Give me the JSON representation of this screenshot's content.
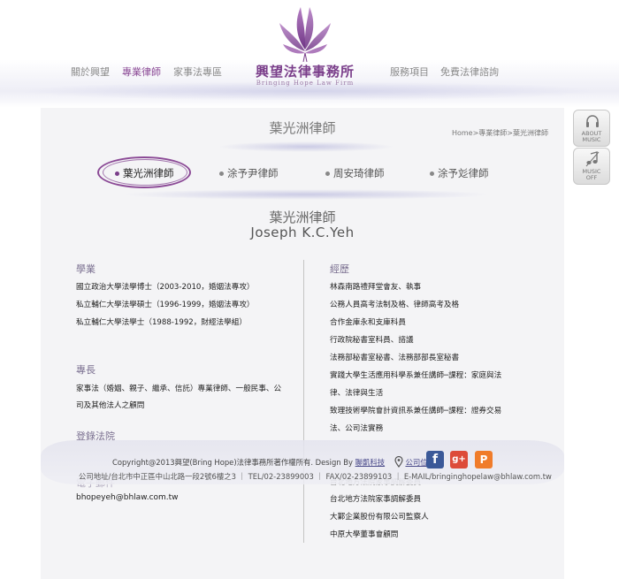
{
  "header": {
    "nav": [
      {
        "label": "關於興望",
        "active": false
      },
      {
        "label": "專業律師",
        "active": true
      },
      {
        "label": "家事法專區",
        "active": false
      },
      {
        "label": "服務項目",
        "active": false
      },
      {
        "label": "免費法律諮詢",
        "active": false
      }
    ],
    "logo": {
      "name": "興望法律事務所",
      "sub": "Bringing Hope Law Firm"
    }
  },
  "music": {
    "on": {
      "line1": "ABOUT",
      "line2": "MUSIC"
    },
    "off": {
      "line1": "MUSIC",
      "line2": "OFF"
    }
  },
  "page": {
    "title": "葉光洲律師",
    "breadcrumb": [
      "Home",
      ">",
      "專業律師",
      ">",
      "葉光洲律師"
    ]
  },
  "lawyers": [
    {
      "name": "葉光洲律師",
      "active": true
    },
    {
      "name": "涂予尹律師",
      "active": false
    },
    {
      "name": "周安琦律師",
      "active": false
    },
    {
      "name": "涂予彣律師",
      "active": false
    }
  ],
  "profile": {
    "name_cn": "葉光洲律師",
    "name_en": "Joseph K.C.Yeh",
    "education": {
      "title": "學業",
      "items": [
        "國立政治大學法學博士（2003-2010，婚姻法專攻）",
        "私立輔仁大學法學碩士（1996-1999，婚姻法專攻）",
        "私立輔仁大學法學士（1988-1992，財經法學組）"
      ]
    },
    "specialty": {
      "title": "專長",
      "lines": [
        "家事法（婚姻、親子、繼承、信託）專業律師、一般民事、公",
        "司及其他法人之顧問"
      ]
    },
    "bar": {
      "title": "登錄法院"
    },
    "contact": {
      "title": "電子郵件",
      "email": "bhopeyeh@bhlaw.com.tw"
    },
    "experience": {
      "title": "經歷",
      "lines": [
        "林森南路禮拜堂會友、執事",
        "公務人員高考法制及格、律師高考及格",
        "合作金庫永和支庫科員",
        "行政院秘書室科員、諮議",
        "法務部秘書室秘書、法務部部長室秘書",
        "實踐大學生活應用科學系兼任講師─課程：家庭與法",
        "律、法律與生活",
        "致理技術學院會計資訊系兼任講師─課程：證券交易",
        "法、公司法實務"
      ],
      "more_title": "台北地方法院家事調解委員",
      "more": [
        "台北地方法院家事調解委員",
        "大鄴企業股份有限公司監察人",
        "中原大學董事會顧問"
      ]
    }
  },
  "footer": {
    "copyright": "Copyright@2013興望(Bring Hope)法律事務所著作權所有. Design By",
    "designer": "聯凱科技",
    "location": "公司位置",
    "address": "公司地址/台北市中正區中山北路一段2號6樓之3 ｜ TEL/02-23899003 ｜ FAX/02-23899103 ｜ E-MAIL/bringinghopelaw@bhlaw.com.tw"
  },
  "social": [
    {
      "icon": "facebook-icon",
      "glyph": "f",
      "color": "#3b5998"
    },
    {
      "icon": "google-plus-icon",
      "glyph": "g+",
      "color": "#dd4b39"
    },
    {
      "icon": "blog-icon",
      "glyph": "P",
      "color": "#f07c2a"
    }
  ],
  "colors": {
    "brand": "#7a3e8a",
    "accent": "#8b4a96"
  }
}
